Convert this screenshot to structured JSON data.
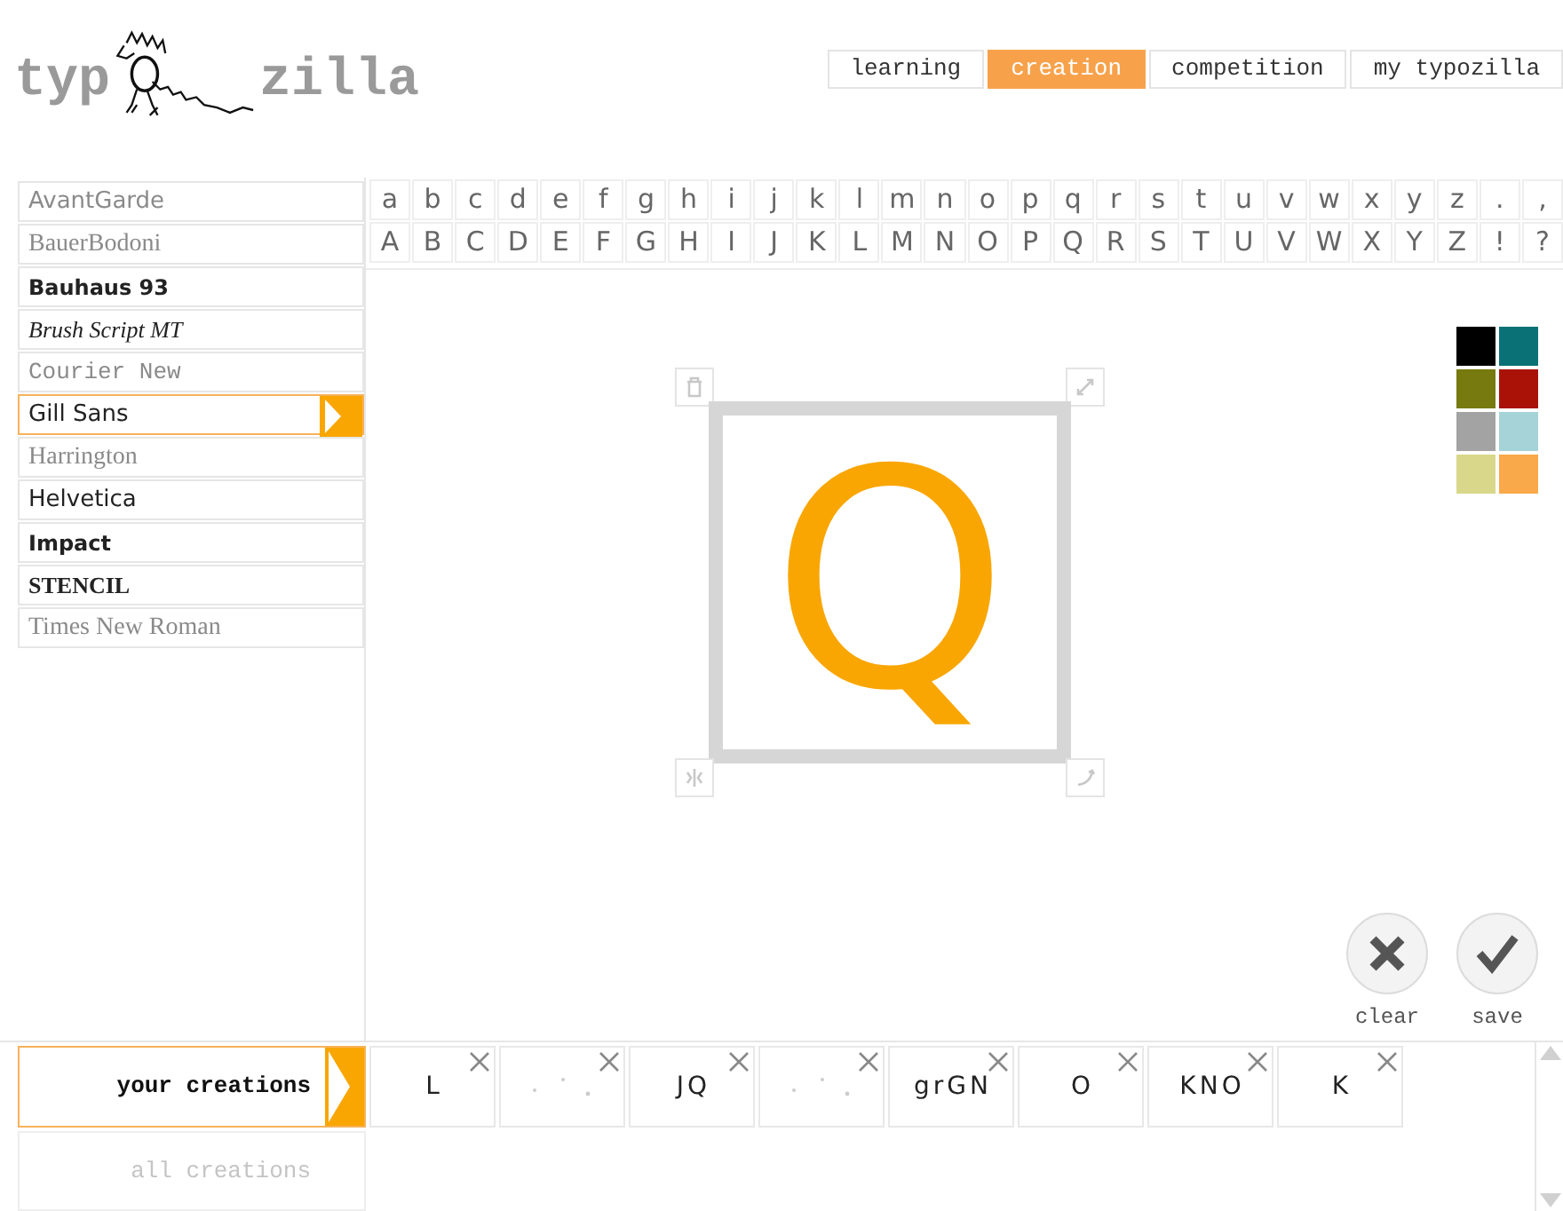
{
  "logo": {
    "left": "typ",
    "right": "zilla"
  },
  "nav_tabs": [
    {
      "label": "learning",
      "selected": false
    },
    {
      "label": "creation",
      "selected": true
    },
    {
      "label": "competition",
      "selected": false
    },
    {
      "label": "my typozilla",
      "selected": false
    }
  ],
  "fonts": [
    {
      "name": "AvantGarde",
      "kind": "sans",
      "dimmed": true,
      "selected": false
    },
    {
      "name": "BauerBodoni",
      "kind": "serif",
      "dimmed": true,
      "selected": false
    },
    {
      "name": "Bauhaus 93",
      "kind": "bold",
      "dimmed": false,
      "selected": false
    },
    {
      "name": "Brush Script MT",
      "kind": "script",
      "dimmed": false,
      "selected": false
    },
    {
      "name": "Courier New",
      "kind": "mono",
      "dimmed": true,
      "selected": false
    },
    {
      "name": "Gill Sans",
      "kind": "sans",
      "dimmed": false,
      "selected": true
    },
    {
      "name": "Harrington",
      "kind": "serif",
      "dimmed": true,
      "selected": false
    },
    {
      "name": "Helvetica",
      "kind": "sans",
      "dimmed": false,
      "selected": false
    },
    {
      "name": "Impact",
      "kind": "bold",
      "dimmed": false,
      "selected": false
    },
    {
      "name": "STENCIL",
      "kind": "bold-serif",
      "dimmed": false,
      "selected": false
    },
    {
      "name": "Times New Roman",
      "kind": "serif",
      "dimmed": true,
      "selected": false
    }
  ],
  "letters_lower": [
    "a",
    "b",
    "c",
    "d",
    "e",
    "f",
    "g",
    "h",
    "i",
    "j",
    "k",
    "l",
    "m",
    "n",
    "o",
    "p",
    "q",
    "r",
    "s",
    "t",
    "u",
    "v",
    "w",
    "x",
    "y",
    "z",
    ".",
    ","
  ],
  "letters_upper": [
    "A",
    "B",
    "C",
    "D",
    "E",
    "F",
    "G",
    "H",
    "I",
    "J",
    "K",
    "L",
    "M",
    "N",
    "O",
    "P",
    "Q",
    "R",
    "S",
    "T",
    "U",
    "V",
    "W",
    "X",
    "Y",
    "Z",
    "!",
    "?"
  ],
  "canvas": {
    "letter": "Q",
    "color": "#f9a602"
  },
  "palette": [
    {
      "color": "#000000"
    },
    {
      "color": "#0a7276"
    },
    {
      "color": "#777a0e"
    },
    {
      "color": "#aa1208"
    },
    {
      "color": "#a3a3a3"
    },
    {
      "color": "#a5d3d8"
    },
    {
      "color": "#d9d88a"
    },
    {
      "color": "#f9a94a"
    }
  ],
  "actions": [
    {
      "kind": "clear",
      "label": "clear"
    },
    {
      "kind": "save",
      "label": "save"
    }
  ],
  "creation_tabs": [
    {
      "label": "your creations",
      "selected": true
    },
    {
      "label": "all creations",
      "selected": false
    }
  ],
  "creations": [
    {
      "kind": "letters",
      "glyphs": [
        "L"
      ]
    },
    {
      "kind": "dots"
    },
    {
      "kind": "letters",
      "glyphs": [
        "J",
        "Q"
      ]
    },
    {
      "kind": "dots"
    },
    {
      "kind": "letters",
      "glyphs": [
        "g",
        "r",
        "G",
        "N"
      ]
    },
    {
      "kind": "letters",
      "glyphs": [
        "O"
      ]
    },
    {
      "kind": "letters",
      "glyphs": [
        "K",
        "N",
        "O"
      ]
    },
    {
      "kind": "letters",
      "glyphs": [
        "K"
      ]
    }
  ]
}
